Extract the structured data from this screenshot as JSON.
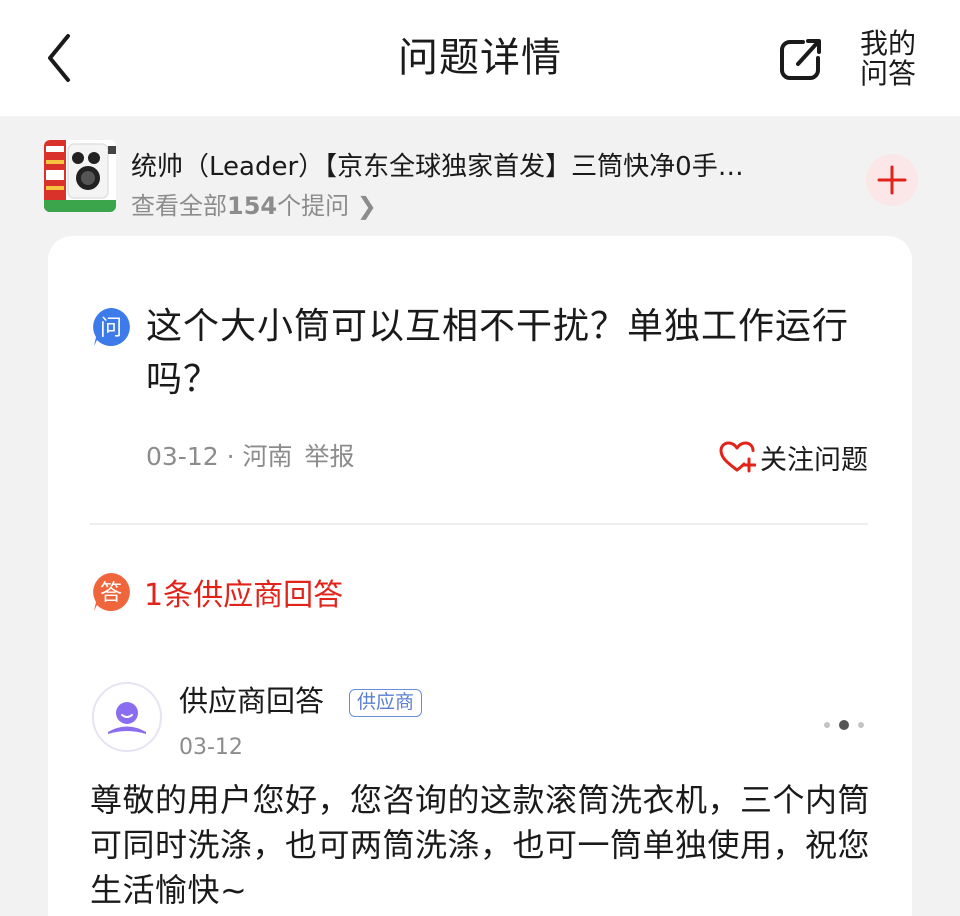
{
  "header": {
    "title": "问题详情",
    "my_answers_line1": "我的",
    "my_answers_line2": "问答",
    "back_icon": "chevron-left-icon",
    "share_icon": "share-icon"
  },
  "product": {
    "name": "统帅（Leader）【京东全球独家首发】三筒快净0手…",
    "view_all_prefix": "查看全部",
    "question_count": "154",
    "view_all_suffix": "个提问 ❯",
    "add_icon": "plus-icon"
  },
  "question": {
    "text": "这个大小筒可以互相不干扰？单独工作运行吗？",
    "date_location": "03-12 · 河南",
    "report_label": "举报",
    "follow_label": "关注问题"
  },
  "answers": {
    "count_label": "1条供应商回答",
    "items": [
      {
        "author": "供应商回答",
        "badge": "供应商",
        "date": "03-12",
        "text": "尊敬的用户您好，您咨询的这款滚筒洗衣机，三个内筒可同时洗涤，也可两筒洗涤，也可一筒单独使用，祝您生活愉快~"
      }
    ]
  },
  "colors": {
    "accent_red": "#e2231a",
    "question_icon_blue": "#3d7bea",
    "answer_icon_orange": "#f0663c",
    "avatar_purple": "#8b6df0",
    "badge_blue": "#5a7fd0"
  }
}
